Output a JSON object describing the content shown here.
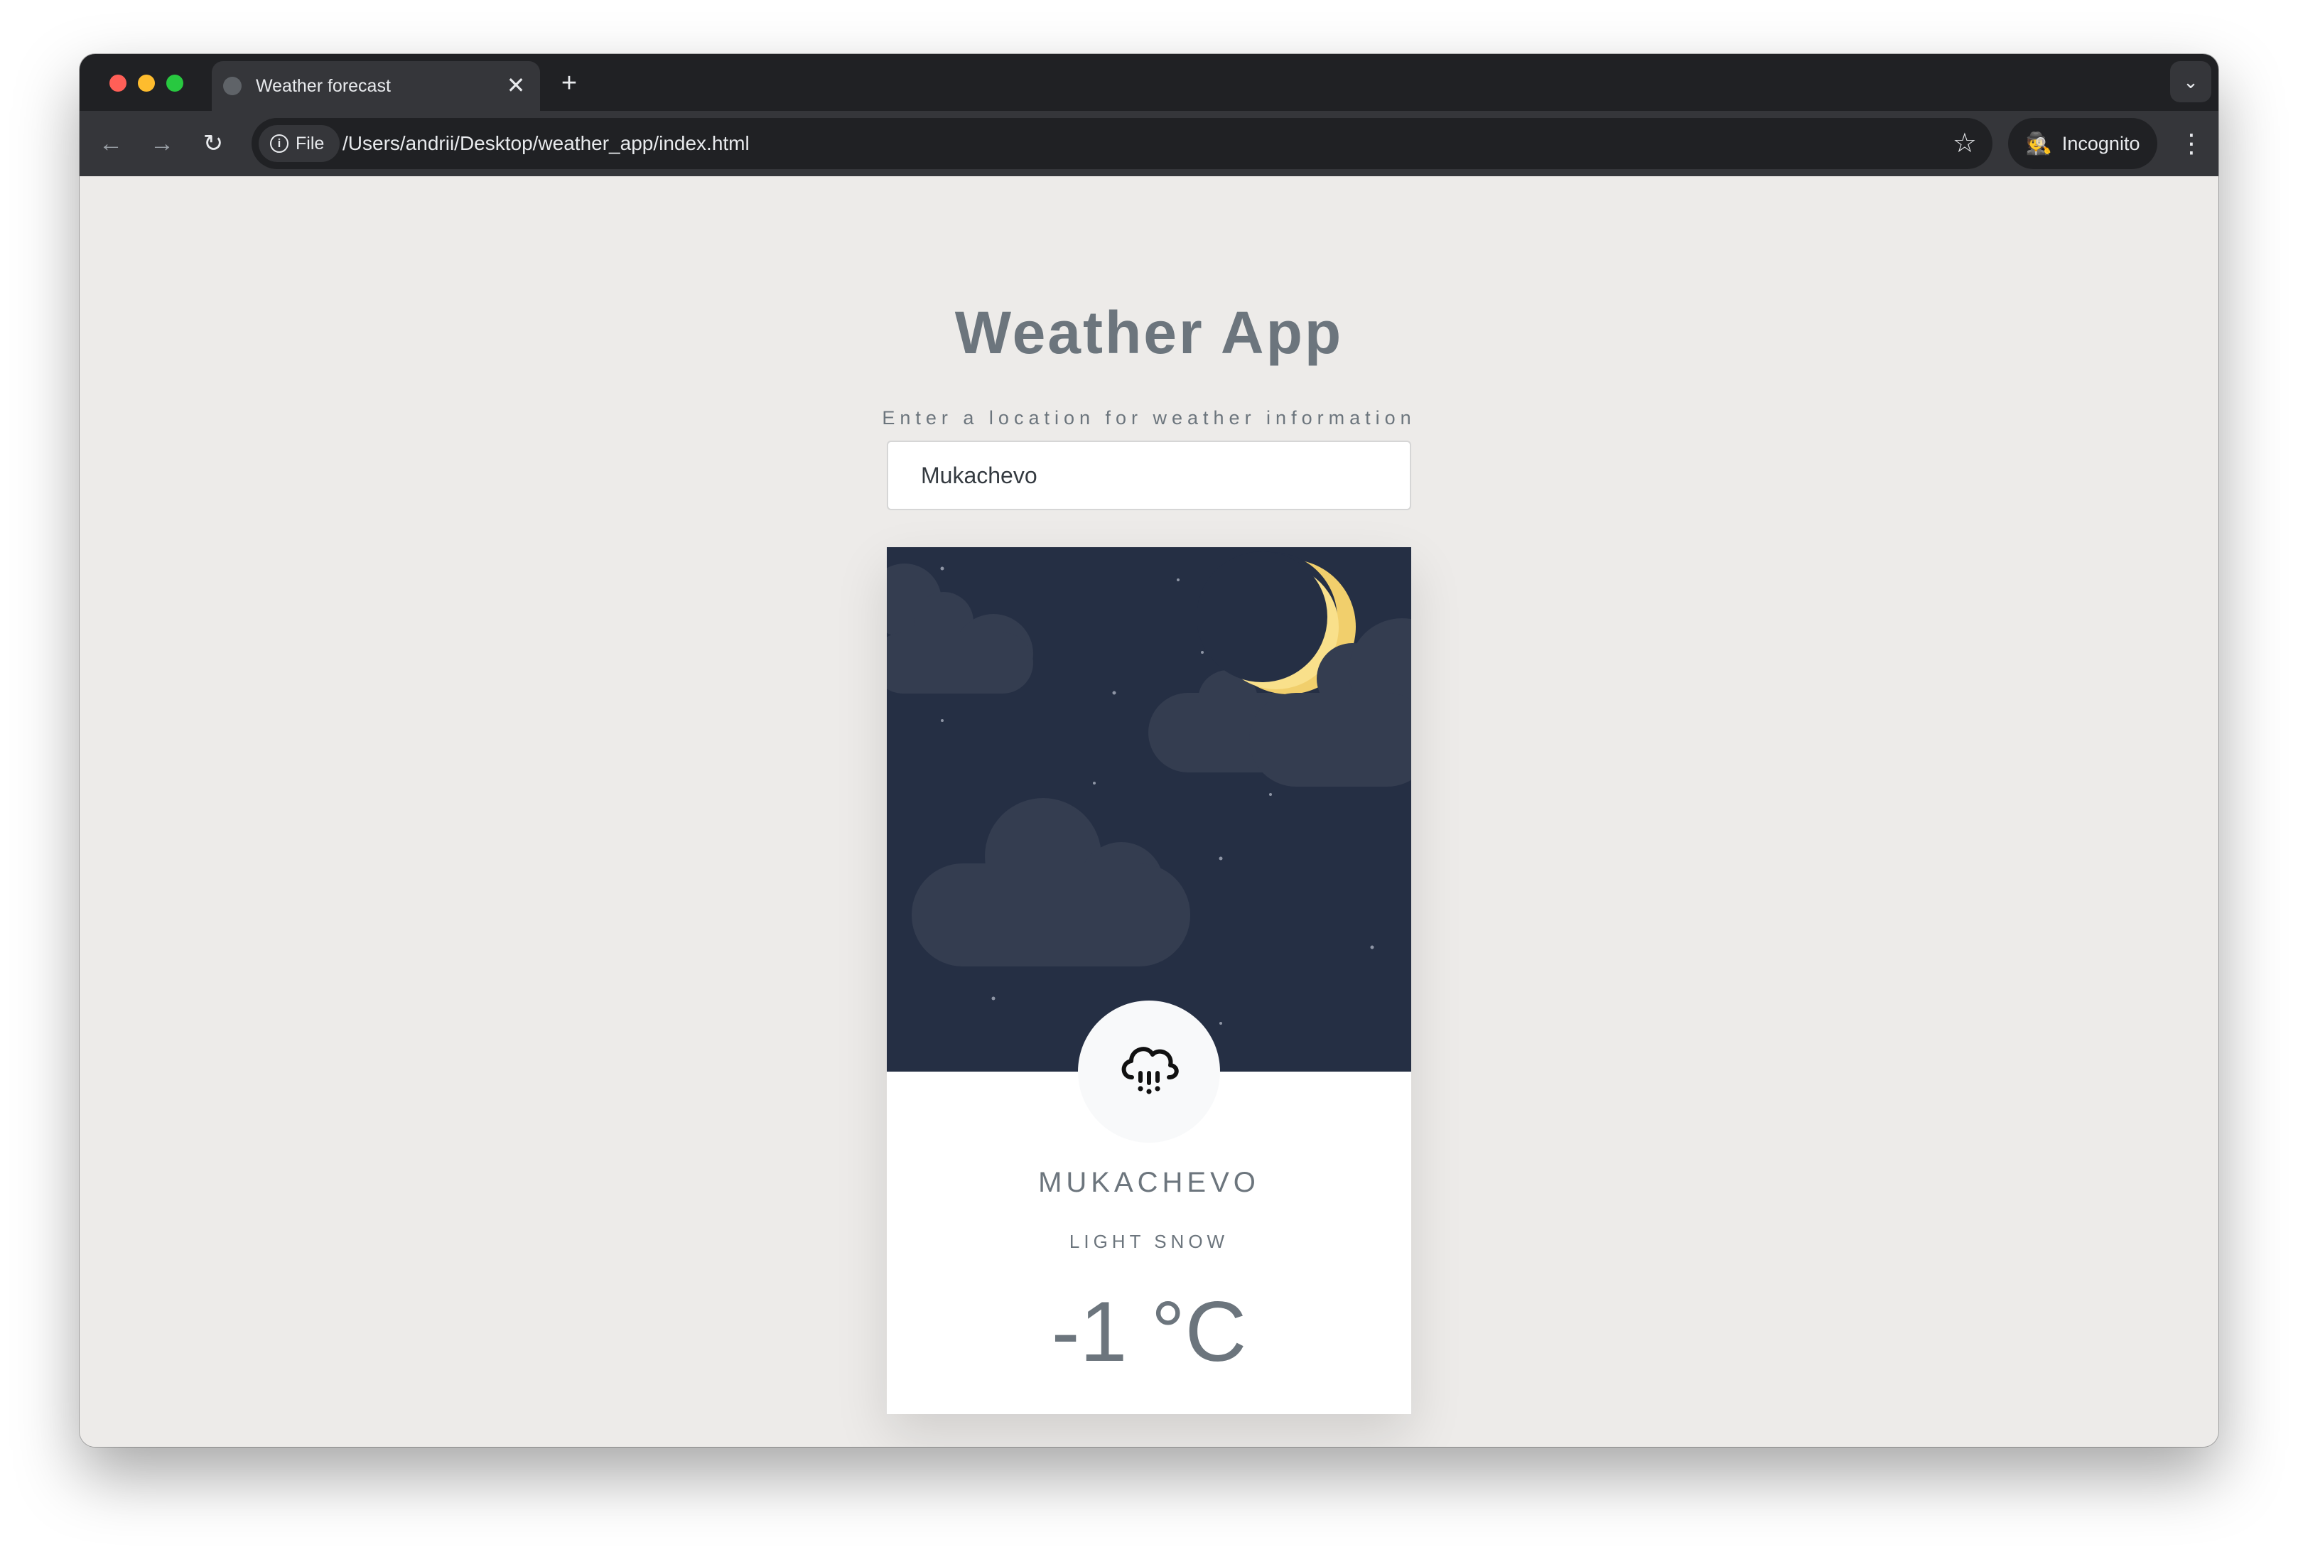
{
  "browser": {
    "tab_title": "Weather forecast",
    "tab_close": "✕",
    "new_tab": "+",
    "file_chip": "File",
    "url": "/Users/andrii/Desktop/weather_app/index.html",
    "incognito_label": "Incognito",
    "icons": {
      "back": "←",
      "forward": "→",
      "reload": "↻",
      "info": "i",
      "star": "☆",
      "incognito": "🕵",
      "menu": "⋮",
      "dropdown": "⌄"
    }
  },
  "app": {
    "title": "Weather App",
    "search_label": "Enter a location for weather information",
    "search_value": "Mukachevo"
  },
  "weather": {
    "city": "MUKACHEVO",
    "condition": "LIGHT SNOW",
    "temperature": "-1 °C",
    "icon": "snow-cloud-icon"
  },
  "colors": {
    "sky": "#252f44",
    "cloud": "#343d50",
    "moon": "#f9e08b",
    "moon_shadow": "#f1cf6c",
    "page_background": "#edebe9",
    "text": "#6c757d"
  }
}
